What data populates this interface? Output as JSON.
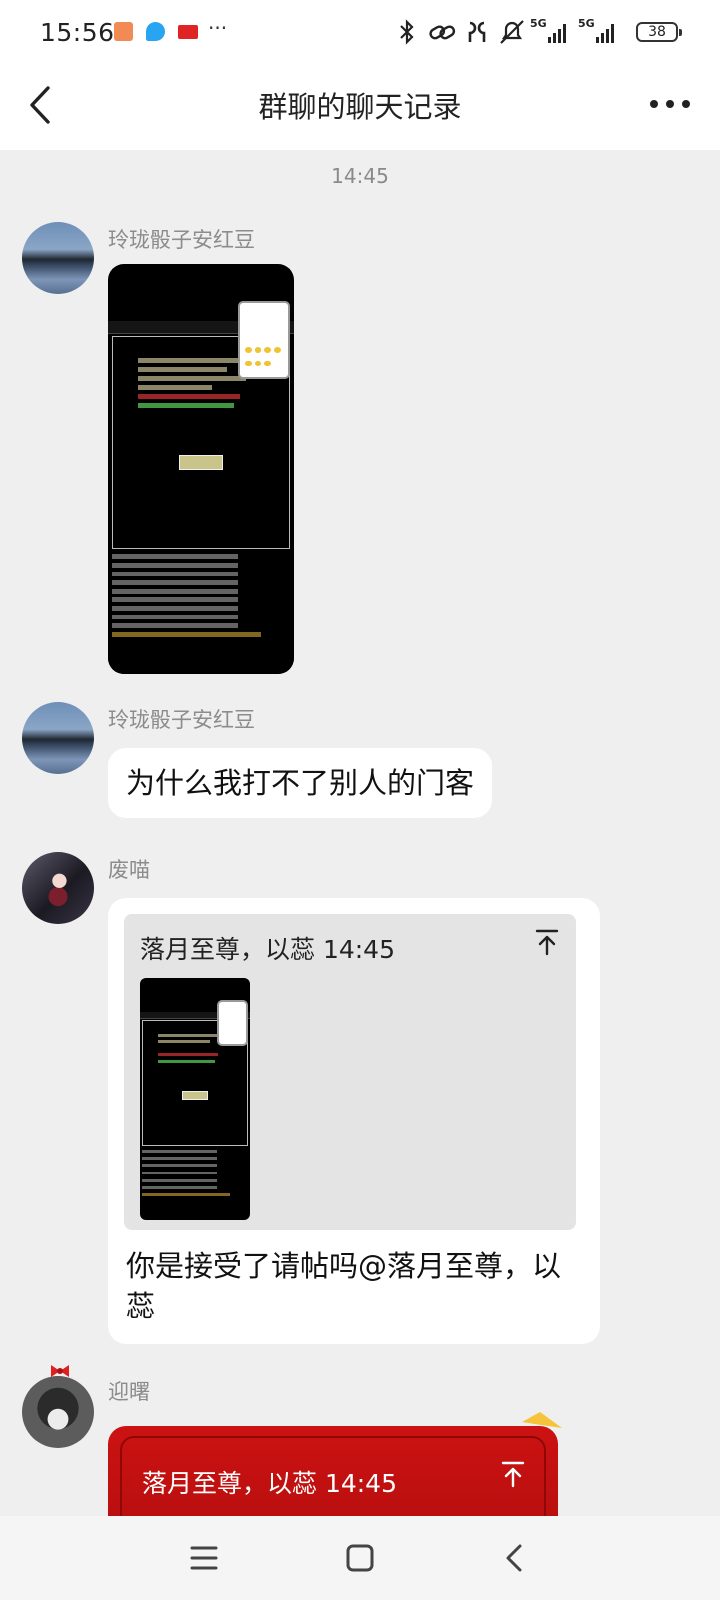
{
  "status_bar": {
    "time": "15:56",
    "notification_icons": [
      "mail-app-icon",
      "bird-app-icon",
      "news-app-icon"
    ],
    "more": "···",
    "network_1": "5G",
    "network_2": "5G",
    "battery": "38"
  },
  "header": {
    "title": "群聊的聊天记录"
  },
  "chat": {
    "timestamp": "14:45",
    "messages": [
      {
        "sender": "玲珑骰子安红豆",
        "type": "image"
      },
      {
        "sender": "玲珑骰子安红豆",
        "type": "text",
        "text": "为什么我打不了别人的门客"
      },
      {
        "sender": "废喵",
        "type": "quote_reply",
        "quote_header": "落月至尊，以蕊 14:45",
        "text": "你是接受了请帖吗@落月至尊，以蕊"
      },
      {
        "sender": "迎曙",
        "type": "quote_reply",
        "quote_header": "落月至尊，以蕊 14:45",
        "bubble_color": "#c41010"
      }
    ]
  },
  "nav_bar": {
    "buttons": [
      "menu",
      "home",
      "back"
    ]
  }
}
